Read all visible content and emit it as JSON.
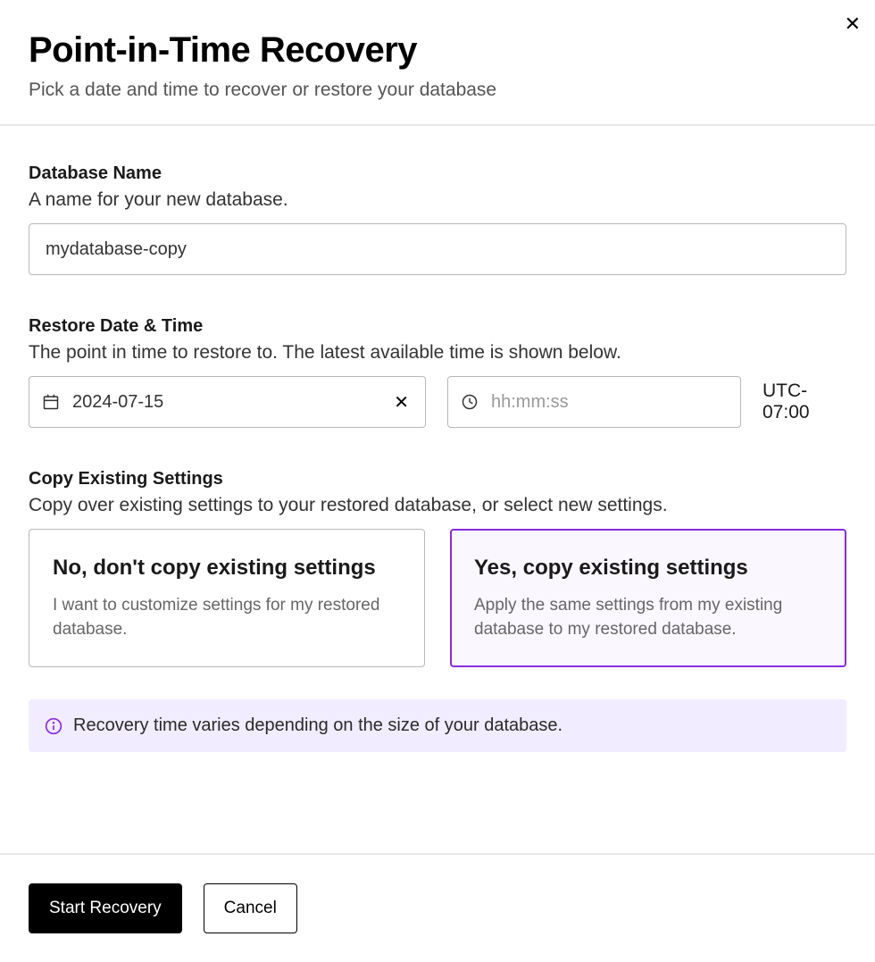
{
  "title": "Point-in-Time Recovery",
  "subtitle": "Pick a date and time to recover or restore your database",
  "dbname": {
    "label": "Database Name",
    "desc": "A name for your new database.",
    "value": "mydatabase-copy"
  },
  "datetime": {
    "label": "Restore Date & Time",
    "desc": "The point in time to restore to. The latest available time is shown below.",
    "date_value": "2024-07-15",
    "time_placeholder": "hh:mm:ss",
    "time_value": "",
    "tz": "UTC-07:00"
  },
  "copy_settings": {
    "label": "Copy Existing Settings",
    "desc": "Copy over existing settings to your restored database, or select new settings.",
    "no": {
      "title": "No, don't copy existing settings",
      "desc": "I want to customize settings for my restored database."
    },
    "yes": {
      "title": "Yes, copy existing settings",
      "desc": "Apply the same settings from my existing database to my restored database."
    }
  },
  "info": {
    "text": "Recovery time varies depending on the size of your database."
  },
  "footer": {
    "primary": "Start Recovery",
    "secondary": "Cancel"
  }
}
